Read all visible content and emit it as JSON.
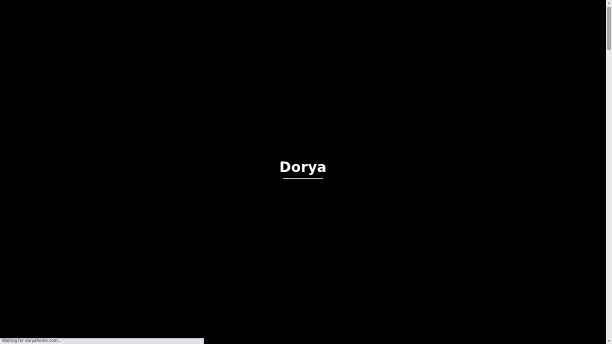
{
  "page": {
    "background_color": "#000000"
  },
  "splash": {
    "logo_text": "Dorya",
    "logo_color": "#ffffff",
    "loader_progress": 1.0
  },
  "status_bar": {
    "text": "Waiting for doryahome.com..."
  }
}
